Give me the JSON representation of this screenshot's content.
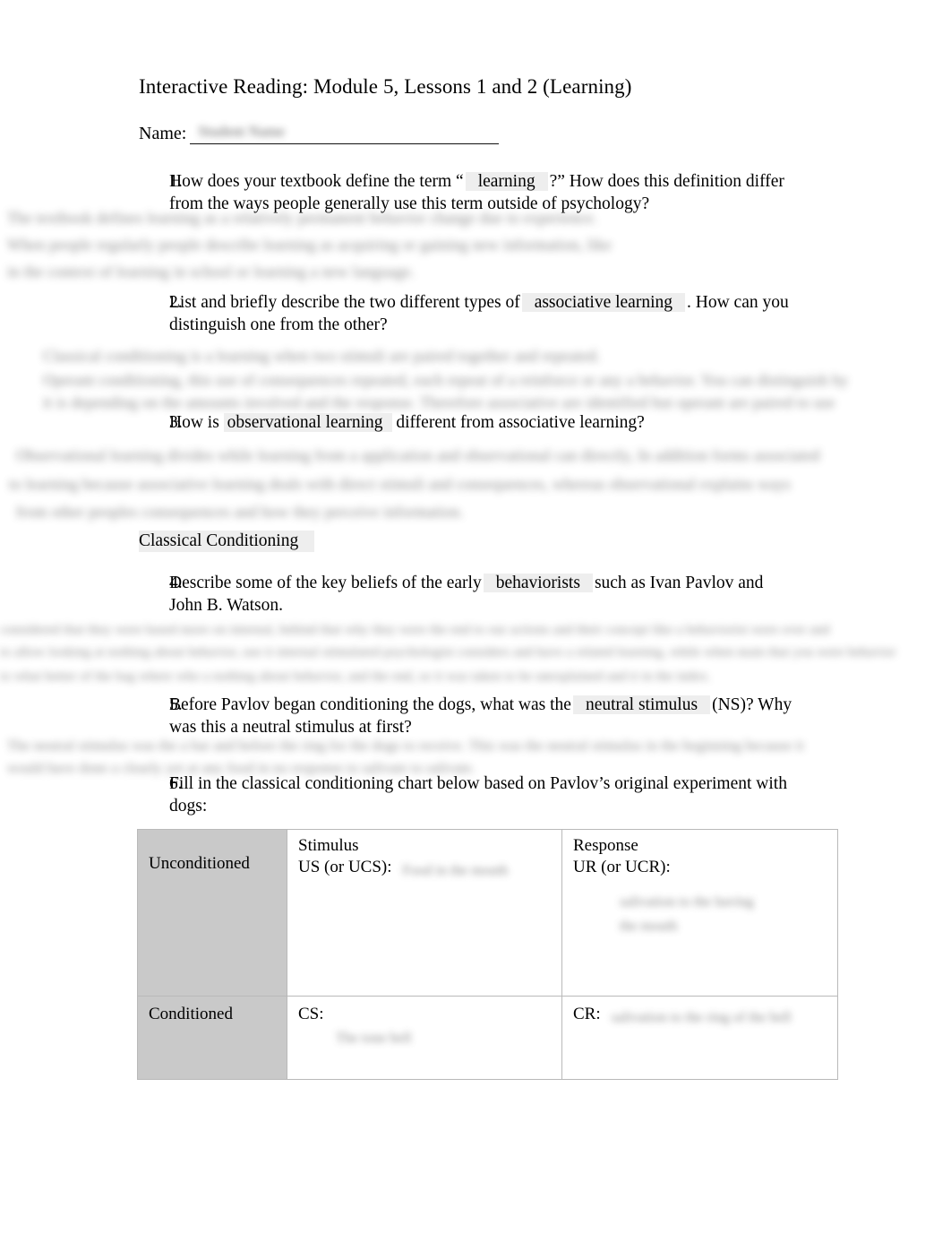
{
  "document": {
    "title": "Interactive Reading: Module 5, Lessons 1 and 2 (Learning)",
    "name_label": "Name:",
    "name_value": "Student Name"
  },
  "questions": [
    {
      "number": "1.",
      "text_before": "How does your textbook define the term “",
      "highlight": "learning",
      "text_after": "?” How does this definition differ from the ways people generally use this term outside of psychology?"
    },
    {
      "number": "2.",
      "text_before": "List and briefly describe the two different types of",
      "highlight": "associative learning",
      "text_after": ". How can you distinguish one from the other?"
    },
    {
      "number": "3.",
      "text_before": "How is",
      "highlight": "observational learning",
      "text_after": "different from associative learning?"
    },
    {
      "number": "4.",
      "text_before": "Describe some of the key beliefs of the early",
      "highlight": "behaviorists",
      "text_after": "such as Ivan Pavlov and John B. Watson."
    },
    {
      "number": "5.",
      "text_before": "Before Pavlov began conditioning the dogs, what was the",
      "highlight": "neutral stimulus",
      "text_after": "(NS)? Why was this a neutral stimulus at first?"
    },
    {
      "number": "6.",
      "text_before": "Fill in the classical conditioning chart below based on Pavlov’s original experiment with dogs:",
      "highlight": "",
      "text_after": ""
    }
  ],
  "section_heading": "Classical Conditioning",
  "answers": {
    "a1": [
      "The textbook defines learning as a relatively permanent behavior change due to experience.",
      "When people regularly people describe learning as acquiring or gaining new information, like",
      "in the context of learning in school or learning a new language."
    ],
    "a2": [
      "Classical conditioning is a learning when two stimuli are paired together and repeated.",
      "Operant conditioning, this use of consequences repeated, each repeat of a reinforce or any a behavior. You can distinguish by",
      "it is depending on the amounts involved and the response. Therefore associative are identified but operant are paired to use"
    ],
    "a3": [
      "Observational learning divides while learning from a application and observational can directly, In addition forms associated",
      "to learning because associative learning deals with direct stimuli and consequences, whereas observational explains ways",
      "from other peoples consequences and how they perceive information."
    ],
    "a4": [
      "considered that they were based more on internal, behind that why they were the end to our actions and their concept like a behaviorist were over and",
      "to allow looking at nothing about behavior, use it internal stimulated psychologist considers and have a related learning, while when main that you were behavior",
      "to what better of the bag where who a nothing about behavior, and the end, so it was taken to be unexplained and it in the index."
    ],
    "a5": [
      "The neutral stimulus was the a bar and before the ring for the dogs to receive. This was the neutral stimulus in the beginning because it",
      "would have done a clearly yet at any food in no response to salivate to salivate."
    ]
  },
  "table": {
    "columns": [
      "Stimulus",
      "Response"
    ],
    "rows": [
      {
        "label": "Unconditioned",
        "stimulus_label": "US (or UCS):",
        "stimulus_value": "Food in the mouth",
        "response_label": "UR (or UCR):",
        "response_value": [
          "salivation to the having",
          "the mouth"
        ]
      },
      {
        "label": "Conditioned",
        "stimulus_label": "CS:",
        "stimulus_value": "The tone bell",
        "response_label": "CR:",
        "response_value": [
          "salivation to the ring of the bell"
        ]
      }
    ]
  }
}
